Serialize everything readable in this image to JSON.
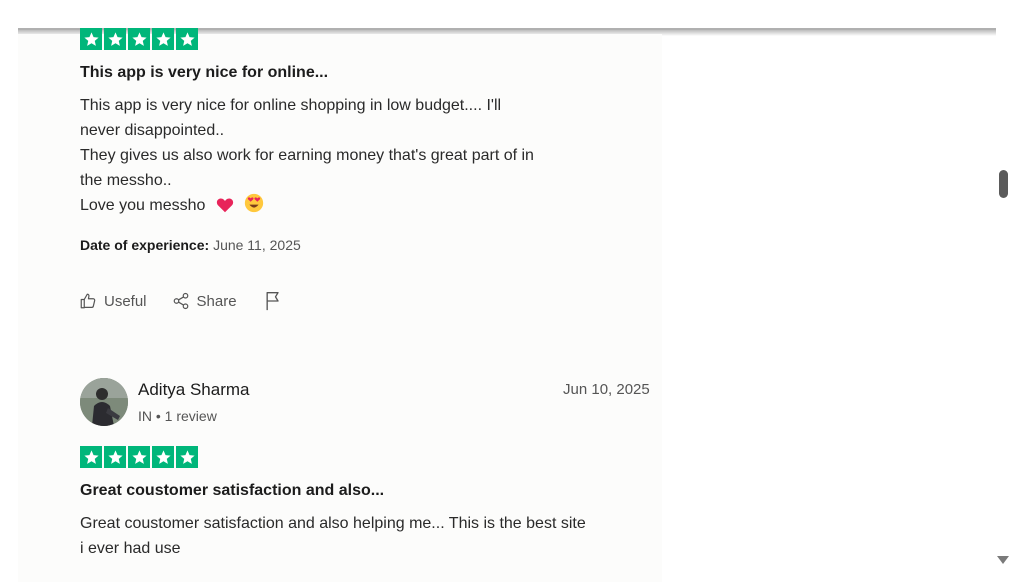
{
  "reviews": [
    {
      "rating_stars": 5,
      "title": "This app is very nice for online...",
      "body_lines": [
        "This app is very nice for online shopping in low budget.... I'll",
        "never disappointed..",
        "They gives us also work for earning money that's great part of in",
        "the messho..",
        "Love you messho"
      ],
      "emojis": [
        "heart-emoji",
        "heart-eyes-emoji"
      ],
      "date_of_experience_label": "Date of experience:",
      "date_of_experience": "June 11, 2025",
      "actions": {
        "useful": "Useful",
        "share": "Share"
      }
    },
    {
      "reviewer_name": "Aditya Sharma",
      "reviewer_meta": "IN • 1 review",
      "date": "Jun 10, 2025",
      "rating_stars": 5,
      "title": "Great coustomer satisfaction and also...",
      "body_lines": [
        "Great coustomer satisfaction and also helping me... This is the best site",
        "i ever had use"
      ]
    }
  ],
  "colors": {
    "star_green": "#00b67a",
    "text": "#1c1c1c",
    "muted": "#555555"
  },
  "icons": [
    "star-icon",
    "thumbs-up-icon",
    "share-icon",
    "flag-icon",
    "scroll-down-arrow-icon"
  ]
}
